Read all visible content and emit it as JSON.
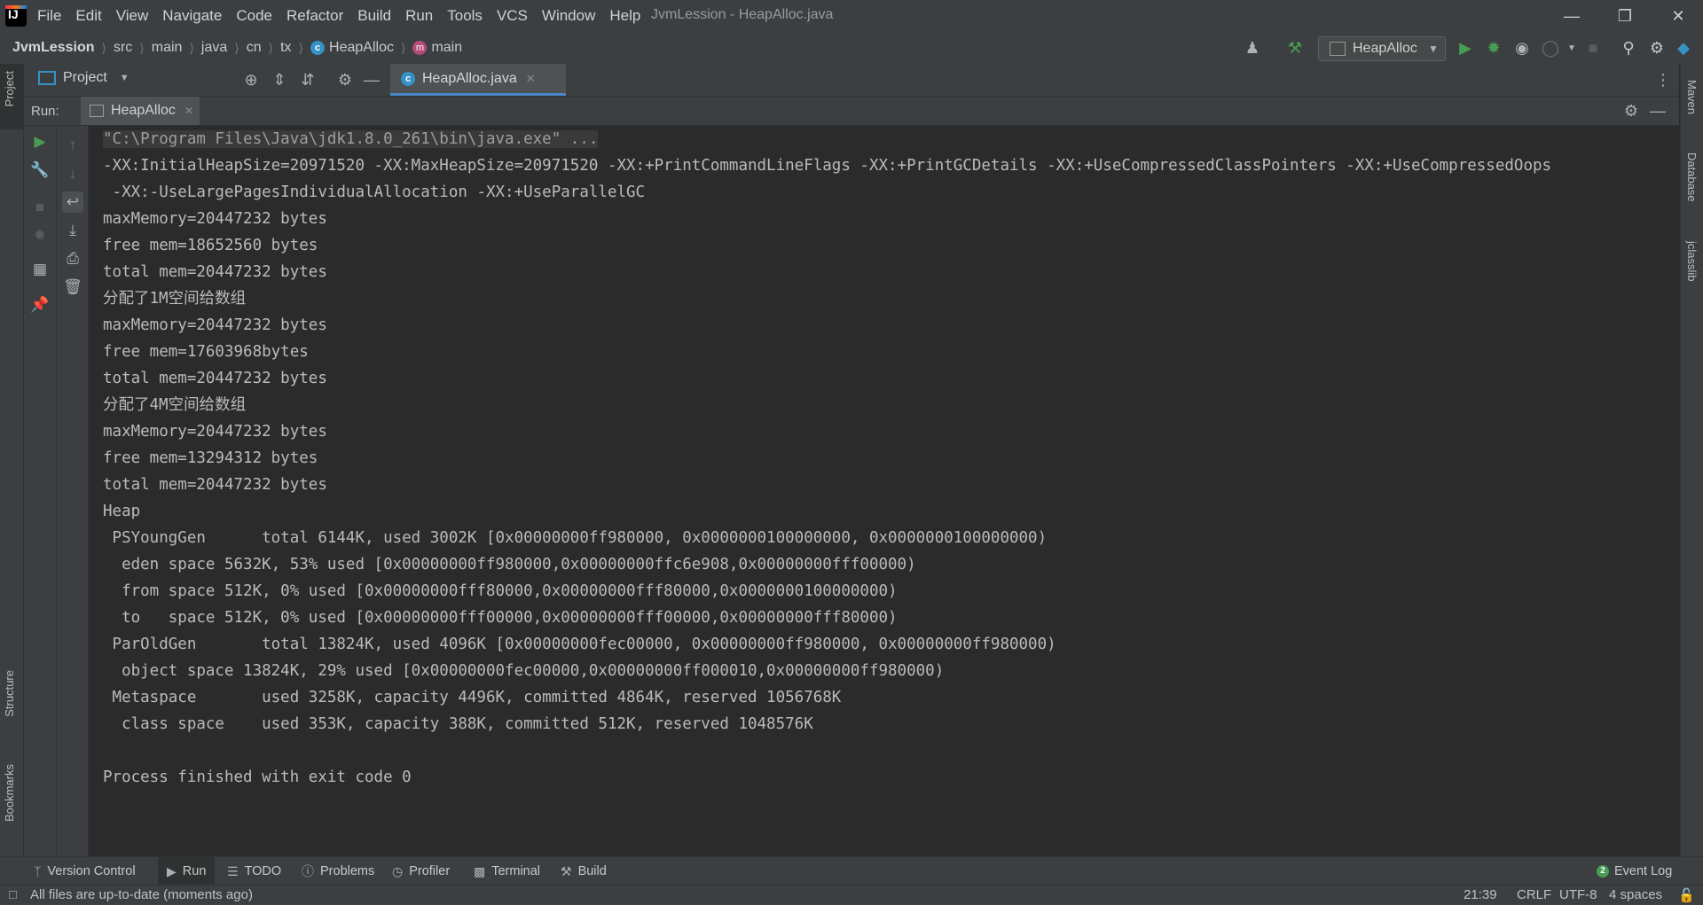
{
  "window": {
    "title": "JvmLession - HeapAlloc.java",
    "menu": [
      "File",
      "Edit",
      "View",
      "Navigate",
      "Code",
      "Refactor",
      "Build",
      "Run",
      "Tools",
      "VCS",
      "Window",
      "Help"
    ]
  },
  "breadcrumb": {
    "project": "JvmLession",
    "items": [
      "src",
      "main",
      "java",
      "cn",
      "tx"
    ],
    "class": "HeapAlloc",
    "method": "main"
  },
  "toolbar": {
    "run_config": "HeapAlloc"
  },
  "left_stripe": {
    "top": "Project",
    "structure": "Structure",
    "bookmarks": "Bookmarks"
  },
  "right_stripe": {
    "maven": "Maven",
    "database": "Database",
    "jclasslib": "jclasslib"
  },
  "project_panel": {
    "label": "Project"
  },
  "editor": {
    "tab": "HeapAlloc.java"
  },
  "run_panel": {
    "label": "Run:",
    "tab": "HeapAlloc"
  },
  "console": {
    "lines": [
      "\"C:\\Program Files\\Java\\jdk1.8.0_261\\bin\\java.exe\" ...",
      "-XX:InitialHeapSize=20971520 -XX:MaxHeapSize=20971520 -XX:+PrintCommandLineFlags -XX:+PrintGCDetails -XX:+UseCompressedClassPointers -XX:+UseCompressedOops",
      " -XX:-UseLargePagesIndividualAllocation -XX:+UseParallelGC",
      "maxMemory=20447232 bytes",
      "free mem=18652560 bytes",
      "total mem=20447232 bytes",
      "分配了1M空间给数组",
      "maxMemory=20447232 bytes",
      "free mem=17603968bytes",
      "total mem=20447232 bytes",
      "分配了4M空间给数组",
      "maxMemory=20447232 bytes",
      "free mem=13294312 bytes",
      "total mem=20447232 bytes",
      "Heap",
      " PSYoungGen      total 6144K, used 3002K [0x00000000ff980000, 0x0000000100000000, 0x0000000100000000)",
      "  eden space 5632K, 53% used [0x00000000ff980000,0x00000000ffc6e908,0x00000000fff00000)",
      "  from space 512K, 0% used [0x00000000fff80000,0x00000000fff80000,0x0000000100000000)",
      "  to   space 512K, 0% used [0x00000000fff00000,0x00000000fff00000,0x00000000fff80000)",
      " ParOldGen       total 13824K, used 4096K [0x00000000fec00000, 0x00000000ff980000, 0x00000000ff980000)",
      "  object space 13824K, 29% used [0x00000000fec00000,0x00000000ff000010,0x00000000ff980000)",
      " Metaspace       used 3258K, capacity 4496K, committed 4864K, reserved 1056768K",
      "  class space    used 353K, capacity 388K, committed 512K, reserved 1048576K",
      "",
      "Process finished with exit code 0"
    ]
  },
  "bottom_tabs": [
    "Version Control",
    "Run",
    "TODO",
    "Problems",
    "Profiler",
    "Terminal",
    "Build"
  ],
  "event_log": {
    "count": "2",
    "label": "Event Log"
  },
  "status": {
    "message": "All files are up-to-date (moments ago)",
    "position": "21:39",
    "line_sep": "CRLF",
    "encoding": "UTF-8",
    "indent": "4 spaces"
  },
  "colors": {
    "accent": "#4a88c7",
    "run_green": "#499c54",
    "background": "#2b2b2b",
    "panel": "#3c3f41"
  }
}
